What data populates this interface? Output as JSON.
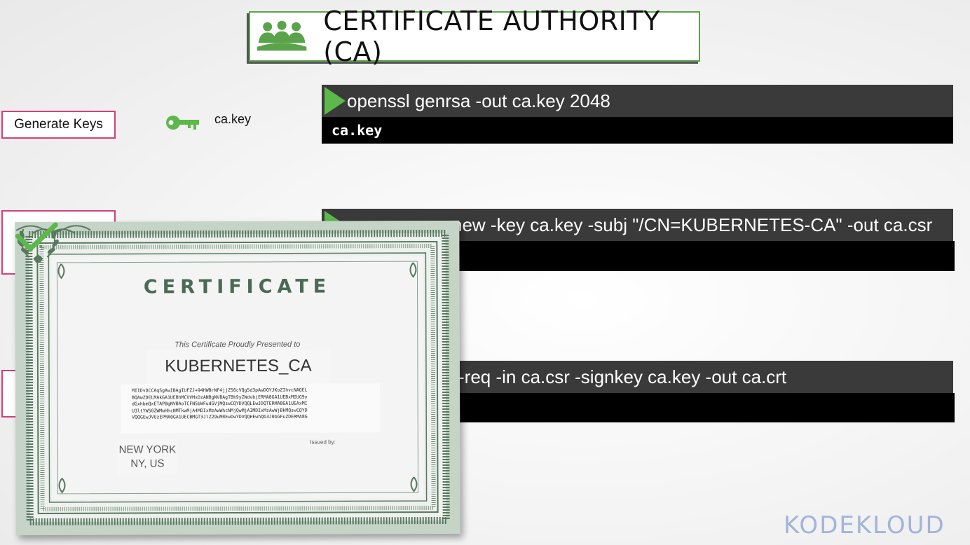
{
  "header": {
    "title": "CERTIFICATE AUTHORITY (CA)",
    "icon": "group-icon",
    "accent": "#5aa34a"
  },
  "steps": [
    {
      "label": "Generate Keys",
      "file_label": "ca.key",
      "file_icon": "key-icon"
    }
  ],
  "commands": [
    {
      "text": "openssl genrsa -out ca.key 2048",
      "output": "ca.key"
    },
    {
      "text": "new -key ca.key -subj  \"/CN=KUBERNETES-CA\" -out ca.csr",
      "output": ""
    },
    {
      "text": "-req -in ca.csr -signkey ca.key -out ca.crt",
      "output": ""
    }
  ],
  "certificate": {
    "title": "CERTIFICATE",
    "subtitle": "This Certificate Proudly Presented to",
    "name": "KUBERNETES_CA",
    "code_lines": [
      "MIIDvDCCAqSgAwIBAgIUFZJ+94HWBrNF4jjZS6cVQg5d3pAwDQYJKoZIhvcNAQEL",
      "BQAwZDELMAkGA1UEBhMCVVMxDzANBgNVBAgTBk9yZWdvbjERMA8GA1UEBxMIUG9y",
      "dGxhbmQxETAPBgNVBAoTCFN5bWFudGVjMQswCQYDVQQLEwJDQTERMA8GA1UEAxMI",
      "U3ltYW50ZWMwHhcNMTkwMjA4MDIxMzAwWhcNMjQwMjA3MDIxMzAwWjBkMQswCQYD",
      "VQQGEwJVUzEPMA0GA1UECBMGT3JlZ29uMREwDwYDVQQHEwhQb3J0bGFuZDERMA8G"
    ],
    "location_line1": "NEW YORK",
    "location_line2": "NY, US",
    "issued_label": "Issued by:"
  },
  "brand": {
    "logo": "KODEKLOUD",
    "color": "#a2b4d9"
  }
}
